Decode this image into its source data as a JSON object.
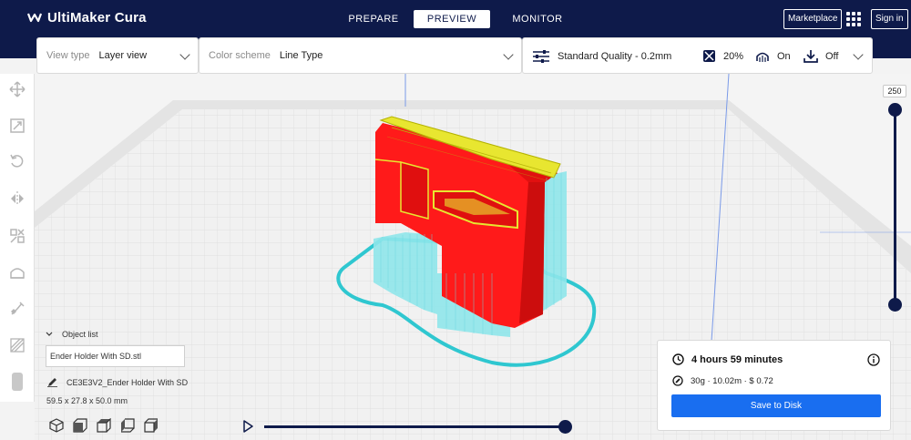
{
  "app": {
    "title": "UltiMaker Cura"
  },
  "stages": [
    {
      "label": "PREPARE"
    },
    {
      "label": "PREVIEW"
    },
    {
      "label": "MONITOR"
    }
  ],
  "header": {
    "marketplace": "Marketplace",
    "sign_in": "Sign in"
  },
  "view_panel": {
    "label": "View type",
    "value": "Layer view"
  },
  "color_panel": {
    "label": "Color scheme",
    "value": "Line Type"
  },
  "print_settings": {
    "profile": "Standard Quality - 0.2mm",
    "infill": "20%",
    "support": "On",
    "adhesion": "Off"
  },
  "layer_slider": {
    "max_layer": "250",
    "current_fraction": 1.0
  },
  "object_list": {
    "header": "Object list",
    "filename": "Ender Holder With SD.stl",
    "job_name": "CE3E3V2_Ender Holder With SD",
    "dimensions": "59.5 x 27.8 x 50.0 mm"
  },
  "print_info": {
    "time": "4 hours 59 minutes",
    "material": "30g · 10.02m · $ 0.72",
    "save_button": "Save to Disk"
  },
  "colors": {
    "navy": "#0e1a4a",
    "accent_blue": "#196ef0",
    "wall_red": "#ff1a1a",
    "top_yellow": "#e8e630",
    "support_cyan": "#59e0e6"
  },
  "icons": {
    "tools": [
      "move-icon",
      "scale-icon",
      "rotate-icon",
      "mirror-icon",
      "per-model-settings-icon",
      "support-blocker-icon",
      "paint-icon",
      "tree-support-icon",
      "filament-icon"
    ],
    "camera_views": [
      "3d-view-icon",
      "front-view-icon",
      "top-view-icon",
      "left-view-icon",
      "right-view-icon"
    ]
  }
}
